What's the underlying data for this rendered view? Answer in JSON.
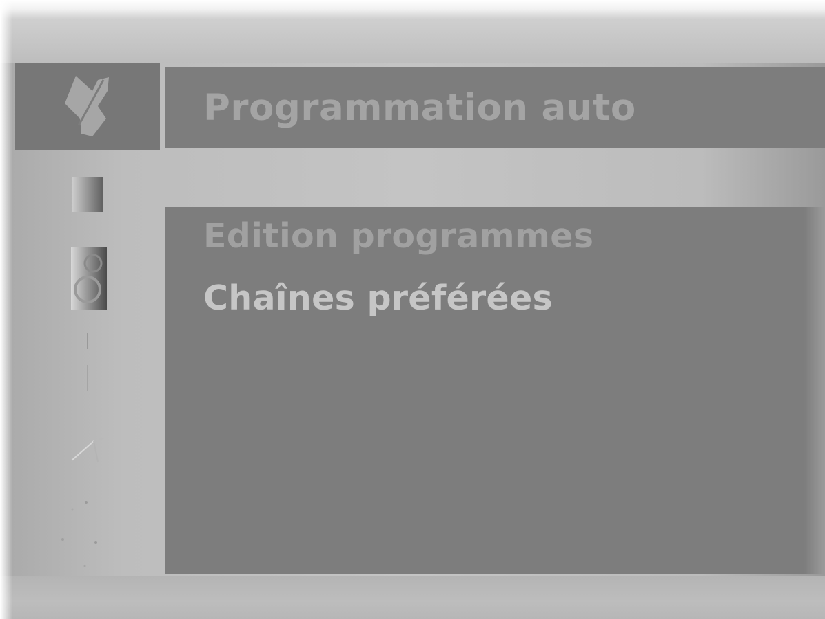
{
  "sidebar": {
    "items": [
      {
        "name": "program-setup-icon",
        "active": true
      },
      {
        "name": "picture-icon",
        "active": false
      },
      {
        "name": "sound-icon",
        "active": false
      },
      {
        "name": "time-icon",
        "active": false
      },
      {
        "name": "special-icon",
        "active": false
      },
      {
        "name": "screen-icon",
        "active": false
      }
    ]
  },
  "header": {
    "title": "Programmation auto"
  },
  "menu": {
    "items": [
      {
        "label": "Edition programmes",
        "state": "dim"
      },
      {
        "label": "Chaînes préférées",
        "state": "bright"
      }
    ]
  },
  "colors": {
    "panel": "#7d7d7d",
    "background": "#c4c4c4",
    "active_tab": "#777777",
    "text_dim": "#a1a1a1",
    "text_bright": "#c6c6c6"
  }
}
